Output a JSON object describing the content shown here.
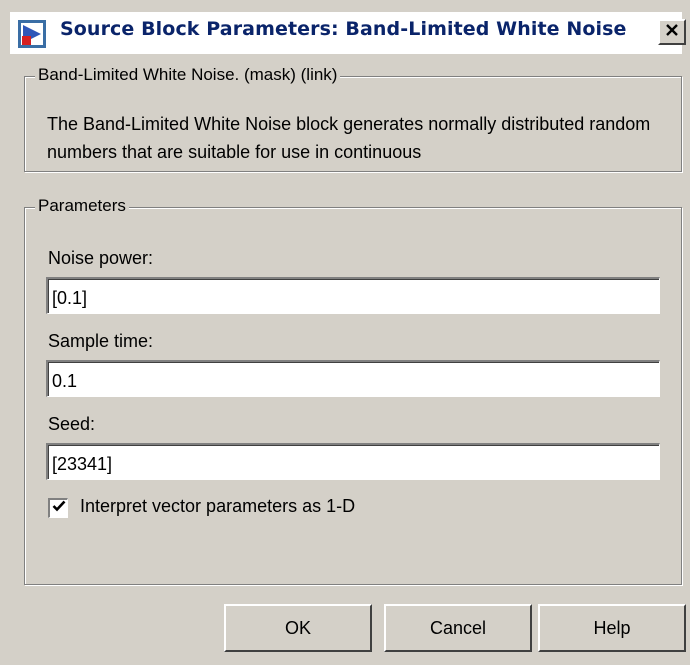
{
  "window": {
    "title": "Source Block Parameters: Band-Limited White Noise",
    "close_label": "X"
  },
  "description_group": {
    "legend": "Band-Limited White Noise. (mask) (link)",
    "text": "The Band-Limited White Noise block generates normally distributed random numbers that are suitable for use in continuous"
  },
  "parameters_group": {
    "legend": "Parameters",
    "fields": [
      {
        "label": "Noise power:",
        "value": "[0.1]"
      },
      {
        "label": "Sample time:",
        "value": "0.1"
      },
      {
        "label": "Seed:",
        "value": "[23341]"
      }
    ],
    "checkbox": {
      "label": "Interpret vector parameters as 1-D",
      "checked": true
    }
  },
  "buttons": {
    "ok": "OK",
    "cancel": "Cancel",
    "help": "Help"
  },
  "colors": {
    "dialog_bg": "#d4d0c8",
    "title_text": "#0a246a"
  },
  "icons": {
    "title": "simulink-block-icon",
    "close": "close-icon",
    "check": "check-icon"
  }
}
